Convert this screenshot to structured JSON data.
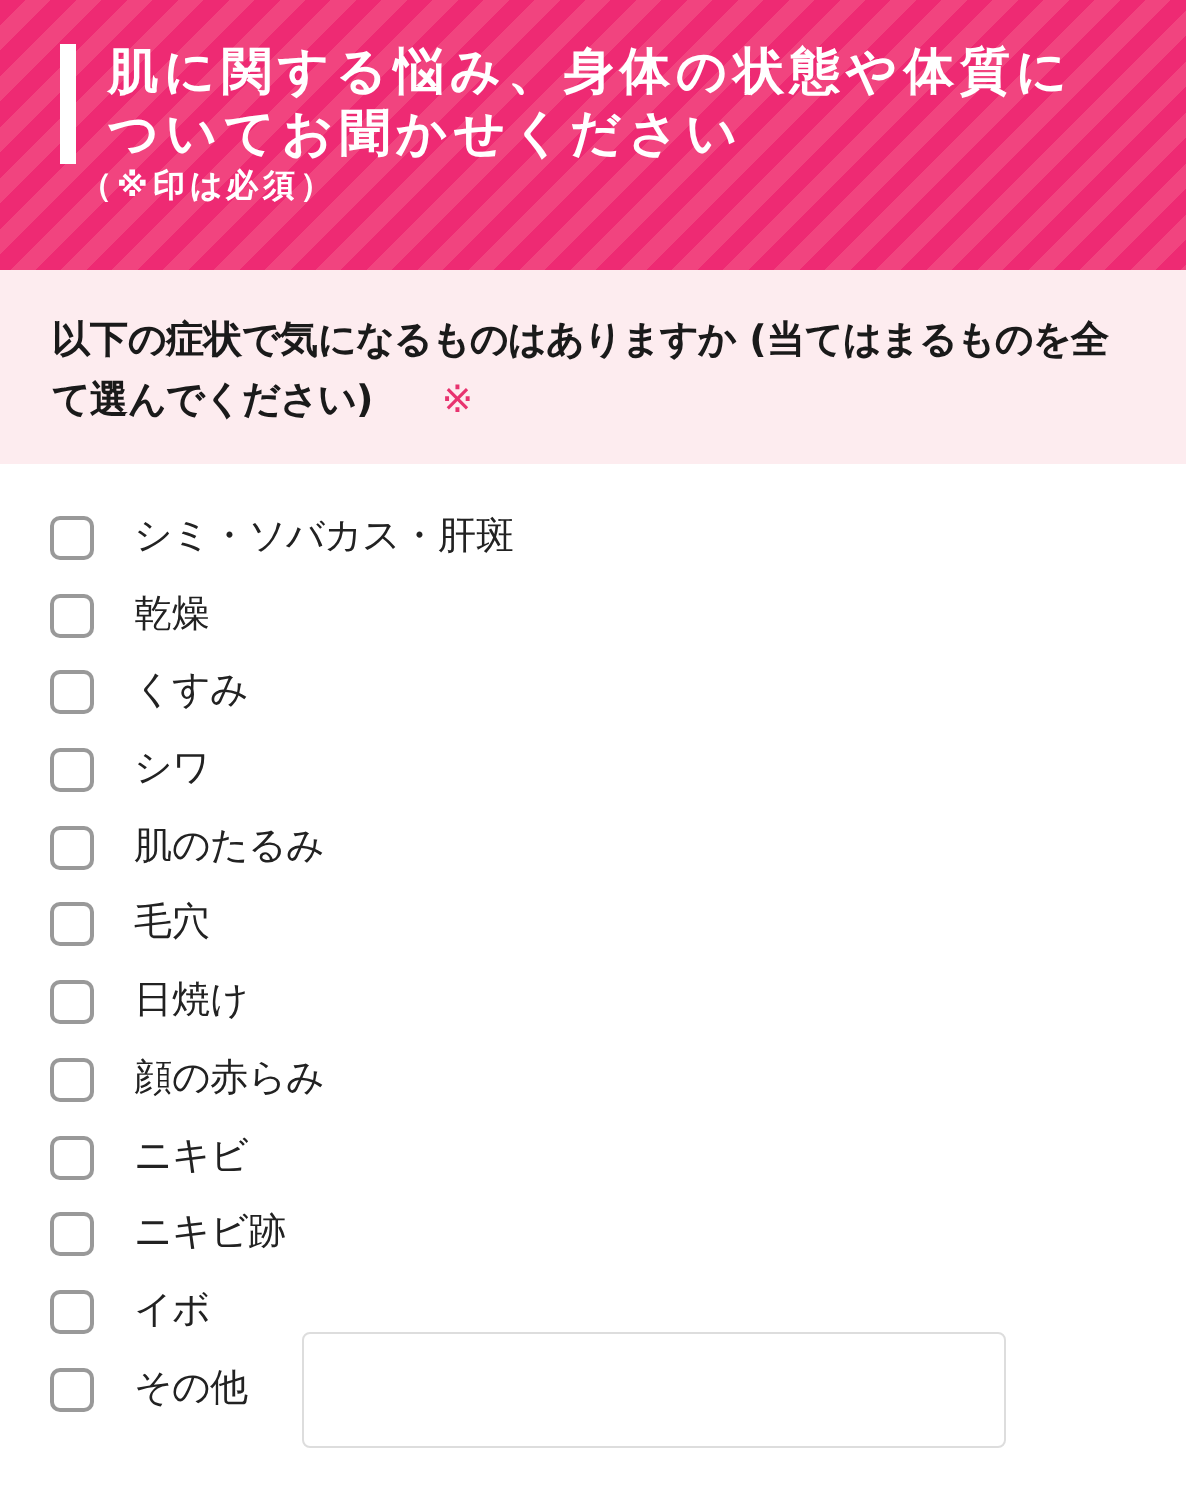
{
  "header": {
    "title": "肌に関する悩み、身体の状態や体質についてお聞かせください",
    "note": "（※印は必須）"
  },
  "question": {
    "text": "以下の症状で気になるものはありますか (当てはまるものを全て選んでください)",
    "required_mark": "※"
  },
  "options": [
    {
      "kind": "checkbox",
      "label": "シミ・ソバカス・肝斑",
      "checked": false
    },
    {
      "kind": "checkbox",
      "label": "乾燥",
      "checked": false
    },
    {
      "kind": "checkbox",
      "label": "くすみ",
      "checked": false
    },
    {
      "kind": "checkbox",
      "label": "シワ",
      "checked": false
    },
    {
      "kind": "checkbox",
      "label": "肌のたるみ",
      "checked": false
    },
    {
      "kind": "checkbox",
      "label": "毛穴",
      "checked": false
    },
    {
      "kind": "checkbox",
      "label": "日焼け",
      "checked": false
    },
    {
      "kind": "checkbox",
      "label": "顔の赤らみ",
      "checked": false
    },
    {
      "kind": "checkbox",
      "label": "ニキビ",
      "checked": false
    },
    {
      "kind": "checkbox",
      "label": "ニキビ跡",
      "checked": false
    },
    {
      "kind": "checkbox",
      "label": "イボ",
      "checked": false
    },
    {
      "kind": "other",
      "label": "その他",
      "checked": false
    }
  ]
}
